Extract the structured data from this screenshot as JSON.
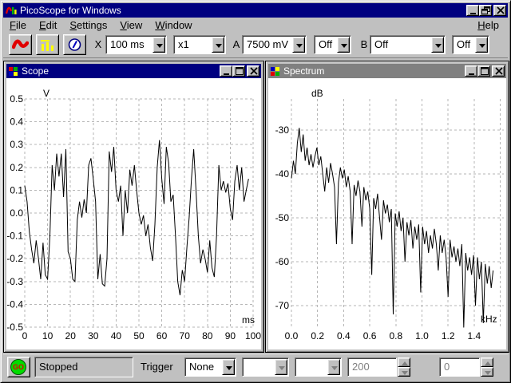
{
  "window": {
    "title": "PicoScope for Windows"
  },
  "menu": {
    "items": [
      "File",
      "Edit",
      "Settings",
      "View",
      "Window"
    ],
    "help": "Help"
  },
  "toolbar": {
    "view_buttons": [
      "scope-view",
      "spectrum-view",
      "meter-view"
    ],
    "x_label": "X",
    "timebase_value": "100 ms",
    "multiplier_value": "x1",
    "a_label": "A",
    "a_range_value": "7500 mV",
    "a_coupling_value": "Off",
    "b_label": "B",
    "b_range_value": "Off",
    "b_coupling_value": "Off"
  },
  "scope_window": {
    "title": "Scope"
  },
  "spectrum_window": {
    "title": "Spectrum"
  },
  "statusbar": {
    "go_label": "GO",
    "status_text": "Stopped",
    "trigger_label": "Trigger",
    "trigger_mode_value": "None",
    "blank1_value": "",
    "blank2_value": "",
    "samples_value": "200",
    "level_value": "0"
  },
  "colors": {
    "active_titlebar": "#000080",
    "inactive_titlebar": "#808080",
    "chrome": "#c0c0c0",
    "plot_background": "#ffffff",
    "grid": "#b6b6b6",
    "trace": "#000000",
    "go_green": "#00dc00",
    "go_text": "#e00000",
    "sine_icon_red": "#e00000",
    "bars_icon_yellow": "#ffff00",
    "meter_icon_blue": "#0000c0",
    "disabled_text": "#808080"
  },
  "chart_data": [
    {
      "id": "scope",
      "type": "line",
      "title": "Scope",
      "xlabel": "ms",
      "ylabel": "V",
      "xlim": [
        0,
        100
      ],
      "ylim": [
        -0.5,
        0.5
      ],
      "grid": "dashed",
      "xticks": [
        0,
        10,
        20,
        30,
        40,
        50,
        60,
        70,
        80,
        90,
        100
      ],
      "xticklabels": [
        "0",
        "10",
        "20",
        "30",
        "40",
        "50",
        "60",
        "70",
        "80",
        "90",
        "100"
      ],
      "yticks": [
        0.5,
        0.4,
        0.3,
        0.2,
        0.1,
        0.0,
        -0.1,
        -0.2,
        -0.3,
        -0.4,
        -0.5
      ],
      "yticklabels": [
        "0.5",
        "0.4",
        "0.3",
        "0.2",
        "0.1",
        "0.0",
        "-0.1",
        "-0.2",
        "-0.3",
        "-0.4",
        "-0.5"
      ],
      "series": {
        "x_start": 0,
        "x_step": 1,
        "x_unit": "ms",
        "y_unit": "V",
        "y": [
          0.12,
          0.05,
          -0.08,
          -0.16,
          -0.22,
          -0.12,
          -0.2,
          -0.29,
          -0.13,
          -0.27,
          -0.29,
          -0.1,
          0.21,
          0.1,
          0.26,
          0.16,
          0.26,
          0.07,
          0.28,
          -0.17,
          -0.2,
          -0.29,
          -0.3,
          -0.03,
          0.05,
          -0.02,
          0.06,
          0.0,
          0.21,
          0.24,
          0.15,
          0.05,
          -0.29,
          -0.18,
          -0.31,
          -0.32,
          -0.2,
          0.27,
          0.18,
          0.29,
          0.1,
          0.05,
          0.12,
          -0.1,
          0.1,
          0.0,
          0.19,
          0.12,
          0.21,
          0.1,
          0.0,
          -0.05,
          -0.01,
          -0.1,
          -0.05,
          -0.15,
          -0.21,
          -0.05,
          0.2,
          0.32,
          0.15,
          0.04,
          0.29,
          0.22,
          0.05,
          0.08,
          -0.1,
          -0.3,
          -0.36,
          -0.25,
          -0.3,
          -0.15,
          -0.02,
          0.15,
          0.28,
          0.1,
          -0.1,
          -0.22,
          -0.16,
          -0.2,
          -0.26,
          -0.12,
          -0.24,
          -0.28,
          -0.1,
          0.21,
          0.1,
          0.14,
          0.09,
          0.13,
          0.02,
          -0.03,
          0.14,
          0.21,
          0.1,
          0.2,
          0.05,
          0.1,
          0.15
        ]
      }
    },
    {
      "id": "spectrum",
      "type": "line",
      "title": "Spectrum",
      "xlabel": "kHz",
      "ylabel": "dB",
      "xlim": [
        0,
        1.6
      ],
      "ylim": [
        -75,
        -23
      ],
      "grid": "dashed",
      "xticks": [
        0.0,
        0.2,
        0.4,
        0.6,
        0.8,
        1.0,
        1.2,
        1.4
      ],
      "xticklabels": [
        "0.0",
        "0.2",
        "0.4",
        "0.6",
        "0.8",
        "1.0",
        "1.2",
        "1.4"
      ],
      "xgrid_extra": [
        1.6
      ],
      "yticks": [
        -30,
        -40,
        -50,
        -60,
        -70
      ],
      "yticklabels": [
        "-30",
        "-40",
        "-50",
        "-60",
        "-70"
      ],
      "series": {
        "x_start": 0,
        "x_step": 0.015,
        "x_unit": "kHz",
        "y_unit": "dB",
        "y": [
          -41,
          -37,
          -40,
          -33,
          -29.5,
          -35,
          -31,
          -37,
          -34,
          -38,
          -35.5,
          -38.5,
          -36,
          -34,
          -38,
          -36,
          -40,
          -44,
          -38.5,
          -42,
          -37.5,
          -40,
          -43,
          -56,
          -42,
          -38.5,
          -41,
          -39,
          -43,
          -40.5,
          -44,
          -56,
          -42.5,
          -45,
          -41.5,
          -44,
          -52,
          -43,
          -46,
          -44,
          -48,
          -63,
          -45.5,
          -48,
          -44.5,
          -50,
          -55,
          -46,
          -49,
          -47,
          -51,
          -48,
          -72,
          -49,
          -52,
          -48.5,
          -53,
          -50,
          -60,
          -51,
          -54,
          -50.5,
          -57,
          -52,
          -55,
          -51.5,
          -67,
          -52,
          -56,
          -53,
          -58,
          -54,
          -57,
          -52.5,
          -56,
          -62,
          -54,
          -58,
          -55,
          -59,
          -68,
          -55,
          -59,
          -56.5,
          -60,
          -57,
          -61,
          -56,
          -75,
          -58,
          -62,
          -59,
          -63,
          -58.5,
          -70,
          -59,
          -64,
          -60,
          -74,
          -60.5,
          -65,
          -61,
          -66,
          -62
        ]
      }
    }
  ]
}
